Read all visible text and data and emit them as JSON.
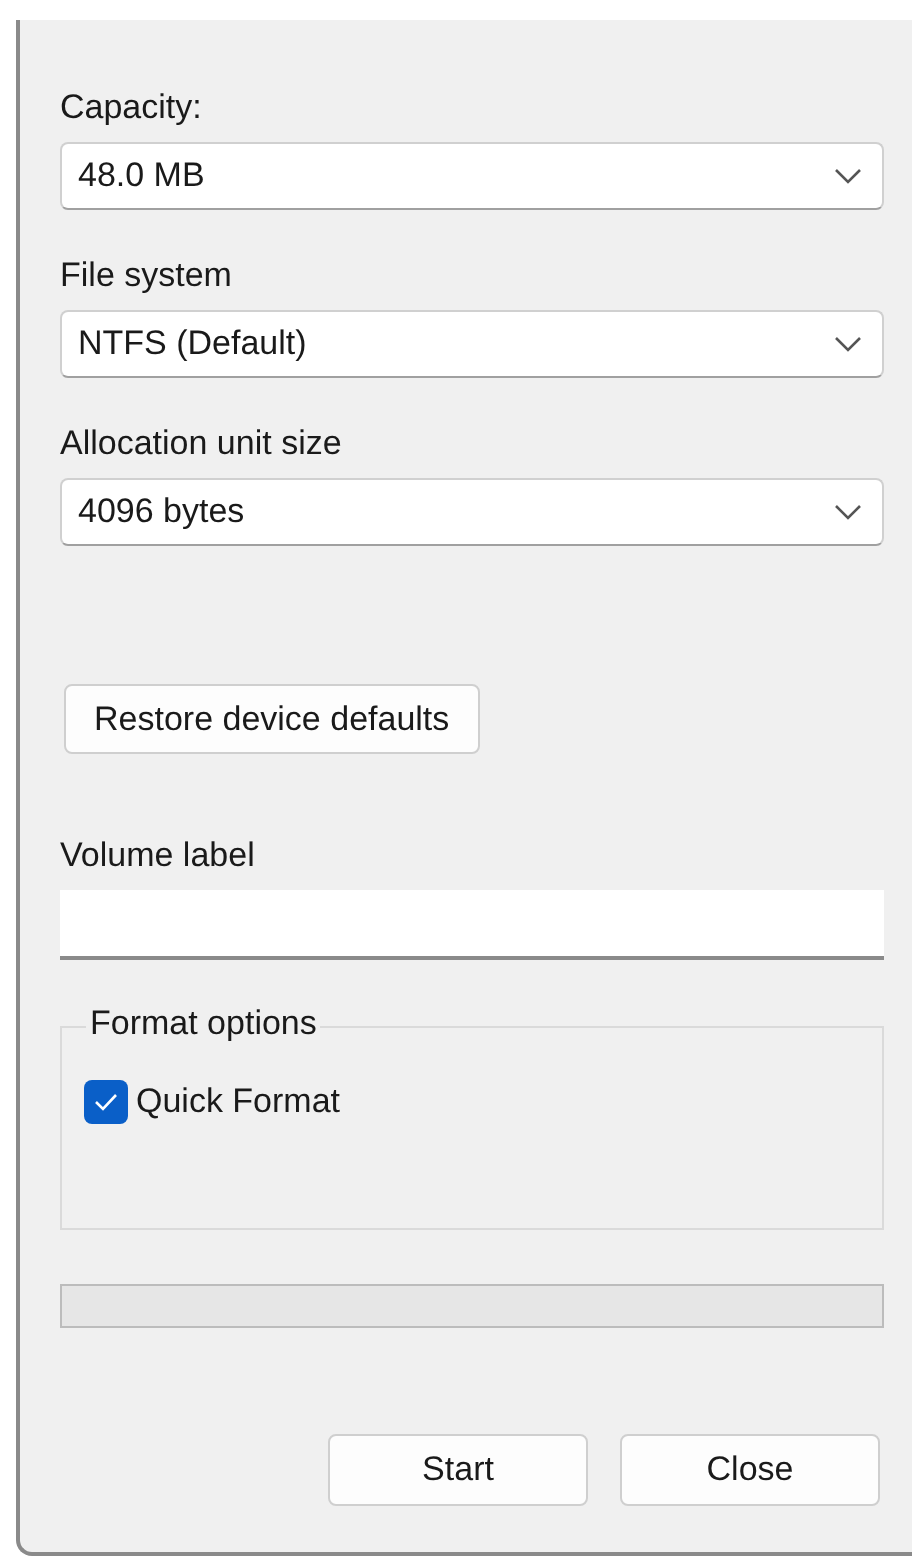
{
  "fields": [
    {
      "label": "Capacity:",
      "value": "48.0 MB"
    },
    {
      "label": "File system",
      "value": "NTFS (Default)"
    },
    {
      "label": "Allocation unit size",
      "value": "4096 bytes"
    }
  ],
  "restore_button": "Restore device defaults",
  "volume_label": {
    "label": "Volume label"
  },
  "format_options": {
    "title": "Format options",
    "options": [
      {
        "label": "Quick Format",
        "checked": true
      }
    ]
  },
  "progress": {
    "level": 0
  },
  "buttons": [
    "Start",
    "Close"
  ]
}
